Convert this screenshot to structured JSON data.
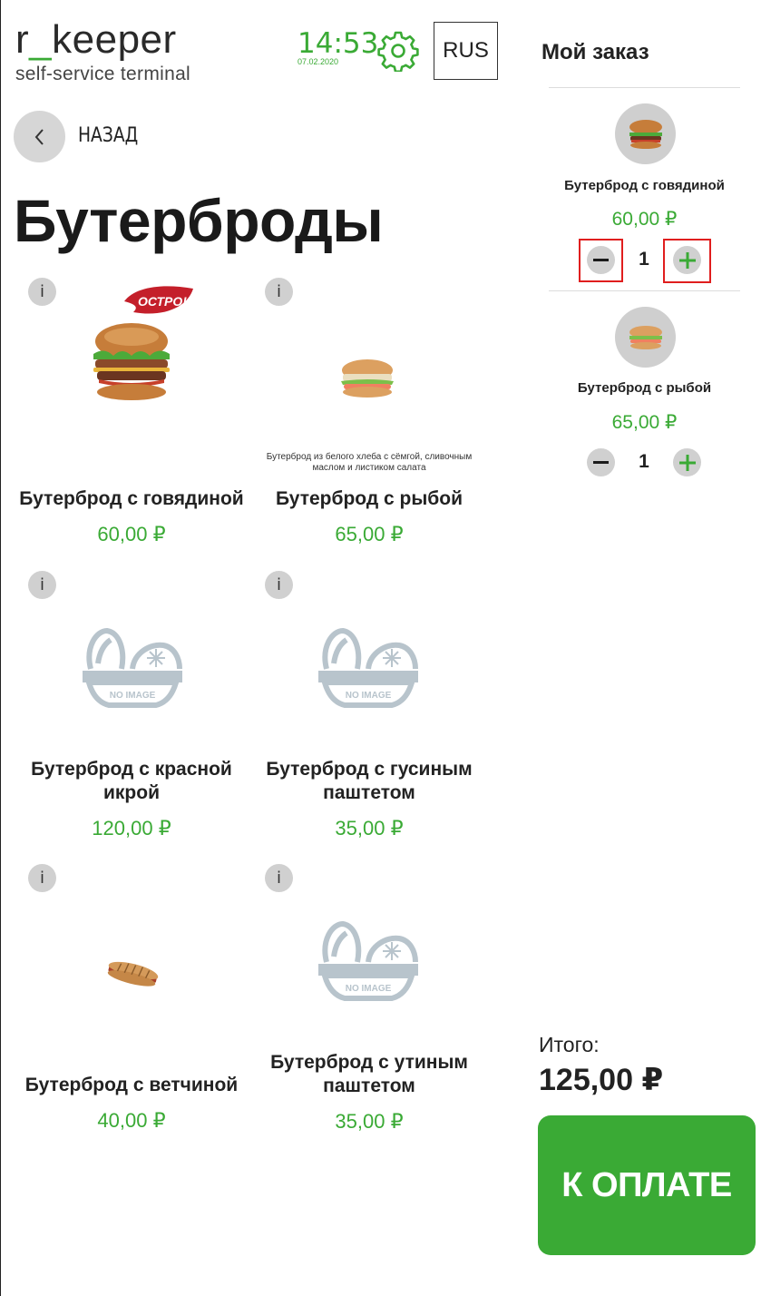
{
  "header": {
    "logo_main_a": "r",
    "logo_main_b": "_",
    "logo_main_c": "keeper",
    "logo_sub": "self-service terminal",
    "time": "14:53",
    "date": "07.02.2020",
    "settings_icon": "gear-icon",
    "language": "RUS"
  },
  "nav": {
    "back_label": "НАЗАД",
    "back_icon": "chevron-left-icon"
  },
  "page_title": "Бутерброды",
  "products": [
    {
      "name": "Бутерброд с говядиной",
      "price": "60,00 ₽",
      "badge": "ОСТРО!",
      "description": "",
      "image": "burger-photo",
      "info": "i"
    },
    {
      "name": "Бутерброд с рыбой",
      "price": "65,00 ₽",
      "badge": "",
      "description": "Бутерброд из белого хлеба с сёмгой, сливочным маслом и листиком салата",
      "image": "fish-sandwich-photo",
      "info": "i"
    },
    {
      "name": "Бутерброд с красной икрой",
      "price": "120,00 ₽",
      "badge": "",
      "description": "",
      "image": "no-image-placeholder",
      "info": "i"
    },
    {
      "name": "Бутерброд с гусиным паштетом",
      "price": "35,00 ₽",
      "badge": "",
      "description": "",
      "image": "no-image-placeholder",
      "info": "i"
    },
    {
      "name": "Бутерброд с ветчиной",
      "price": "40,00 ₽",
      "badge": "",
      "description": "",
      "image": "panini-photo",
      "info": "i"
    },
    {
      "name": "Бутерброд с утиным паштетом",
      "price": "35,00 ₽",
      "badge": "",
      "description": "",
      "image": "no-image-placeholder",
      "info": "i"
    }
  ],
  "no_image_text": "NO IMAGE",
  "order": {
    "title": "Мой заказ",
    "items": [
      {
        "name": "Бутерброд с говядиной",
        "price": "60,00 ₽",
        "qty": "1",
        "highlighted": true
      },
      {
        "name": "Бутерброд с рыбой",
        "price": "65,00 ₽",
        "qty": "1",
        "highlighted": false
      }
    ],
    "total_label": "Итого:",
    "total_value": "125,00 ₽",
    "pay_label": "К ОПЛАТЕ"
  },
  "colors": {
    "accent": "#3aaa35",
    "highlight": "#e01e1e",
    "badge": "#c41f2a",
    "placeholder": "#b8c4cc"
  }
}
